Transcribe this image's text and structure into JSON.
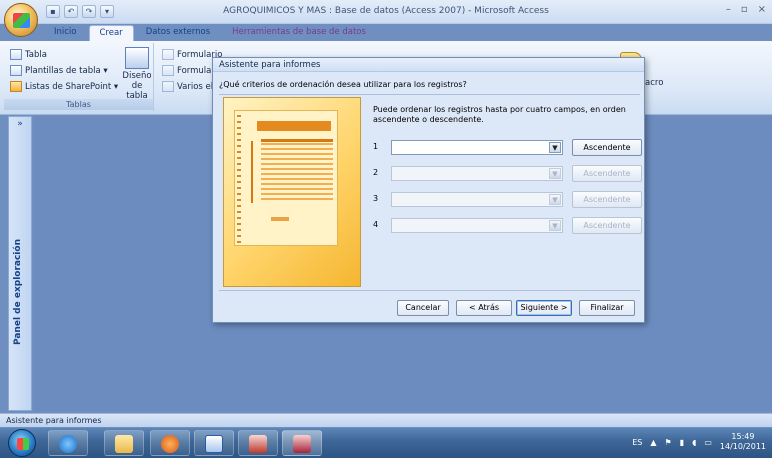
{
  "window": {
    "title": "AGROQUIMICOS Y MAS : Base de datos (Access 2007) - Microsoft Access",
    "controls": [
      "–",
      "▫",
      "×"
    ]
  },
  "qat": [
    "save",
    "undo",
    "redo",
    "customize"
  ],
  "ribbon": {
    "tabs": [
      "Inicio",
      "Crear",
      "Datos externos",
      "Herramientas de base de datos"
    ],
    "active_tab": "Crear",
    "group_tablas": {
      "title": "Tablas",
      "items": [
        "Tabla",
        "Plantillas de tabla ▾",
        "Listas de SharePoint ▾"
      ],
      "design_line1": "Diseño",
      "design_line2": "de tabla"
    },
    "group_forms": {
      "items": [
        "Formulario",
        "Formulario",
        "Varios el"
      ]
    },
    "macro_label": "acro"
  },
  "nav": {
    "chevron": "»",
    "label": "Panel de exploración"
  },
  "dialog": {
    "title": "Asistente para informes",
    "question": "¿Qué criterios de ordenación desea utilizar para los registros?",
    "description": "Puede ordenar los registros hasta por cuatro campos, en orden ascendente o descendente.",
    "sort_rows": [
      {
        "number": "1",
        "field": "",
        "order": "Ascendente",
        "enabled": true
      },
      {
        "number": "2",
        "field": "",
        "order": "Ascendente",
        "enabled": false
      },
      {
        "number": "3",
        "field": "",
        "order": "Ascendente",
        "enabled": false
      },
      {
        "number": "4",
        "field": "",
        "order": "Ascendente",
        "enabled": false
      }
    ],
    "buttons": {
      "cancel": "Cancelar",
      "back": "< Atrás",
      "next": "Siguiente >",
      "finish": "Finalizar"
    }
  },
  "status": {
    "text": "Asistente para informes"
  },
  "taskbar": {
    "language": "ES",
    "time": "15:49",
    "date": "14/10/2011"
  }
}
